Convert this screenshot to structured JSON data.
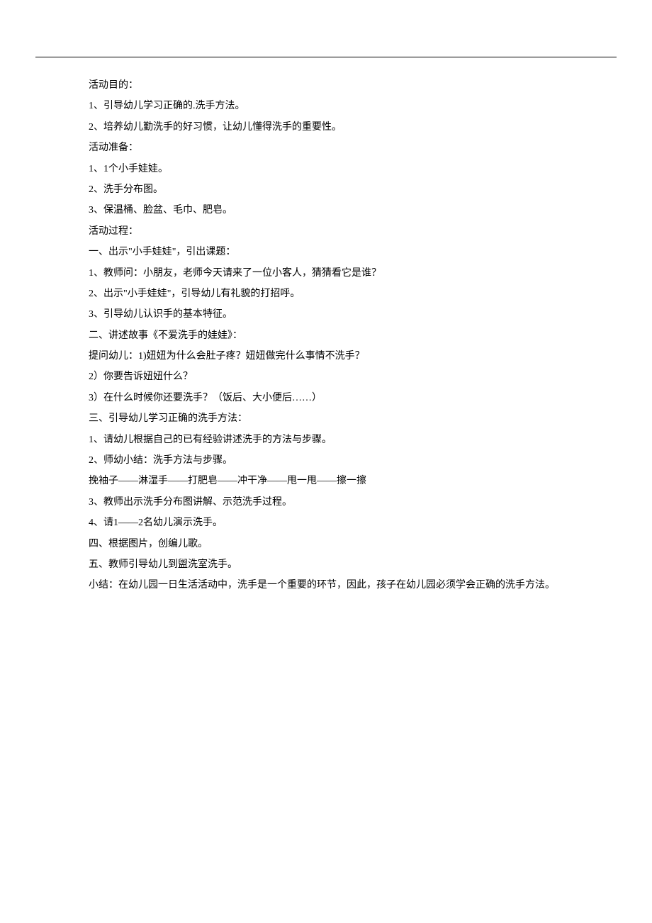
{
  "lines": [
    "活动目的：",
    "1、引导幼儿学习正确的.洗手方法。",
    "2、培养幼儿勤洗手的好习惯，让幼儿懂得洗手的重要性。",
    "活动准备：",
    "1、1个小手娃娃。",
    "2、洗手分布图。",
    "3、保温桶、脸盆、毛巾、肥皂。",
    "活动过程：",
    "一、出示\"小手娃娃\"，引出课题：",
    "1、教师问：小朋友，老师今天请来了一位小客人，猜猜看它是谁？",
    "2、出示\"小手娃娃\"，引导幼儿有礼貌的打招呼。",
    "3、引导幼儿认识手的基本特征。",
    "二、讲述故事《不爱洗手的娃娃》：",
    "提问幼儿：1)妞妞为什么会肚子疼？妞妞做完什么事情不洗手？",
    "2）你要告诉妞妞什么？",
    "3）在什么时候你还要洗手？（饭后、大小便后……）",
    "三、引导幼儿学习正确的洗手方法：",
    "1、请幼儿根据自己的已有经验讲述洗手的方法与步骤。",
    "2、师幼小结：洗手方法与步骤。",
    "挽袖子——淋湿手——打肥皂——冲干净——甩一甩——擦一擦",
    "3、教师出示洗手分布图讲解、示范洗手过程。",
    "4、请1——2名幼儿演示洗手。",
    "四、根据图片，创编儿歌。",
    "五、教师引导幼儿到盥洗室洗手。",
    "小结：在幼儿园一日生活活动中，洗手是一个重要的环节，因此，孩子在幼儿园必须学会正确的洗手方法。"
  ]
}
